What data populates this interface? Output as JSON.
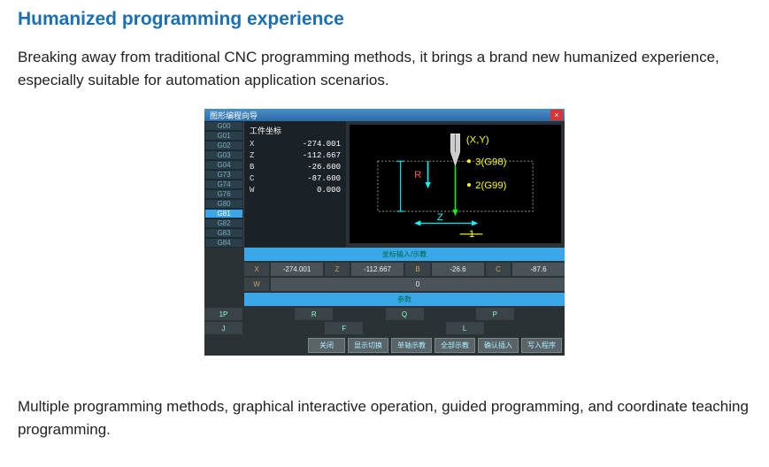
{
  "heading": "Humanized programming experience",
  "intro": "Breaking away from traditional CNC programming methods, it brings a brand new humanized experience, especially suitable for automation application scenarios.",
  "outro": "Multiple programming methods, graphical interactive operation, guided programming, and coordinate teaching programming.",
  "cnc": {
    "title": "图形编程向导",
    "gcodes": [
      "G00",
      "G01",
      "G02",
      "G03",
      "G04",
      "G73",
      "G74",
      "G76",
      "G80",
      "G81",
      "G82",
      "G83",
      "G84"
    ],
    "selected_gcode_index": 9,
    "coord_header": "工件坐标",
    "coords": [
      {
        "axis": "X",
        "val": "-274.001"
      },
      {
        "axis": "Z",
        "val": "-112.667"
      },
      {
        "axis": "B",
        "val": "-26.600"
      },
      {
        "axis": "C",
        "val": "-87.600"
      },
      {
        "axis": "W",
        "val": "0.000"
      }
    ],
    "diagram_labels": {
      "xy": "(X,Y)",
      "g98": "3(G98)",
      "g99": "2(G99)",
      "R": "R",
      "Z": "Z",
      "one": "1"
    },
    "section1": "坐标输入/示教",
    "inputs": [
      {
        "label": "X",
        "val": "-274.001"
      },
      {
        "label": "Z",
        "val": "-112.667"
      },
      {
        "label": "B",
        "val": "-26.6"
      },
      {
        "label": "C",
        "val": "-87.6"
      }
    ],
    "inputs2": [
      {
        "label": "W",
        "val": "0"
      }
    ],
    "section2": "参数",
    "params_row1": [
      "1P",
      "R",
      "Q",
      "P"
    ],
    "params_row2": [
      "J",
      "F",
      "L"
    ],
    "actions": [
      "关闭",
      "显示切换",
      "单轴示教",
      "全部示教",
      "确认插入",
      "写入程序"
    ]
  }
}
